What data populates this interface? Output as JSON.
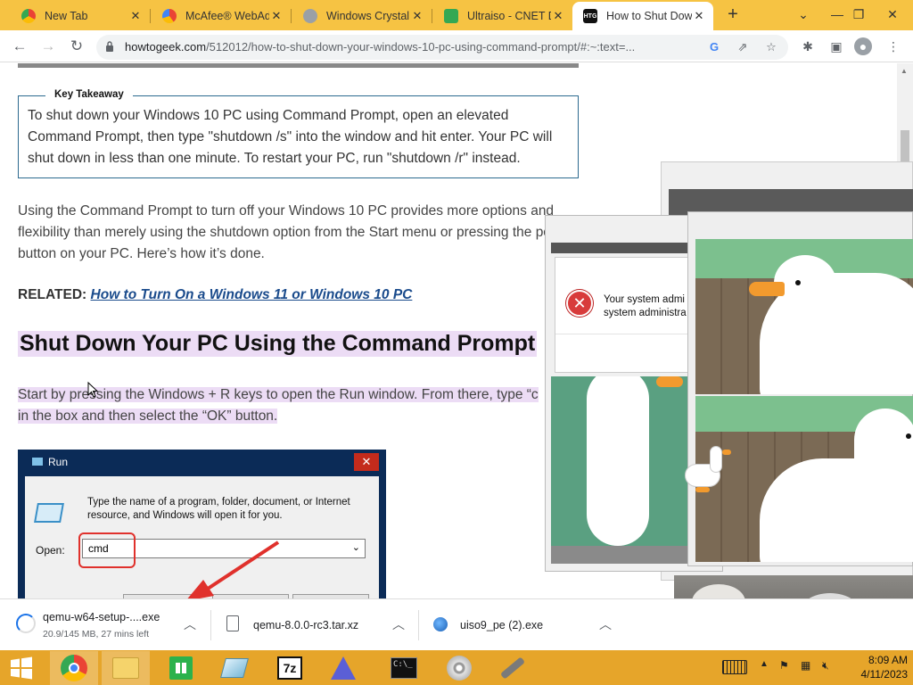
{
  "browser": {
    "tabs": [
      {
        "title": "New Tab",
        "favicon": "chrome-icon",
        "color": "#ffffff",
        "active": false
      },
      {
        "title": "McAfee® WebAd",
        "favicon": "mcafee-icon",
        "color": "#e8453c",
        "active": false
      },
      {
        "title": "Windows Crystal",
        "favicon": "crystal-icon",
        "color": "#9aa0a6",
        "active": false
      },
      {
        "title": "Ultraiso - CNET D",
        "favicon": "cnet-icon",
        "color": "#34a853",
        "active": false
      },
      {
        "title": "How to Shut Dow",
        "favicon": "htg-icon",
        "color": "#111111",
        "active": true
      }
    ],
    "favicon_text": {
      "htg": "HTG"
    },
    "close_glyph": "✕",
    "new_tab_glyph": "+",
    "url_host": "howtogeek.com",
    "url_path": "/512012/how-to-shut-down-your-windows-10-pc-using-command-prompt/#:~:text=...",
    "accent": "#f6c343"
  },
  "article": {
    "takeaway_title": "Key Takeaway",
    "takeaway_body": "To shut down your Windows 10 PC using Command Prompt, open an elevated Command Prompt, then type \"shutdown /s\" into the window and hit enter. Your PC will shut down in less than one minute. To restart your PC, run \"shutdown /r\" instead.",
    "intro": "Using the Command Prompt to turn off your Windows 10 PC provides more options and flexibility than merely using the shutdown option from the Start menu or pressing the power button on your PC. Here’s how it’s done.",
    "related_label": "RELATED:",
    "related_link": "How to Turn On a Windows 11 or Windows 10 PC",
    "heading": "Shut Down Your PC Using the Command Prompt",
    "step_text_1": "Start by pressing the Windows + R keys to open the Run window. From there, type “c",
    "step_text_2": "in the box and then select the “OK” button."
  },
  "run_dialog": {
    "title": "Run",
    "close_glyph": "✕",
    "description": "Type the name of a program, folder, document, or Internet resource, and Windows will open it for you.",
    "open_label": "Open:",
    "open_value": "cmd"
  },
  "error_popup": {
    "message_line1": "Your system admi",
    "message_line2": "system administra"
  },
  "downloads": [
    {
      "name": "qemu-w64-setup-....exe",
      "status": "20.9/145 MB, 27 mins left"
    },
    {
      "name": "qemu-8.0.0-rc3.tar.xz",
      "status": ""
    },
    {
      "name": "uiso9_pe (2).exe",
      "status": ""
    }
  ],
  "taskbar": {
    "time": "8:09 AM",
    "date": "4/11/2023",
    "color": "#e6a52a",
    "sevenzip_label": "7z"
  }
}
